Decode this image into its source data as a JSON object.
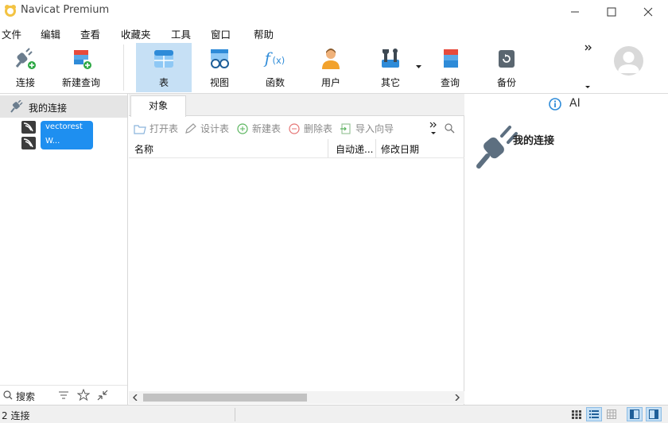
{
  "window": {
    "title": "Navicat Premium"
  },
  "menu": [
    "文件",
    "编辑",
    "查看",
    "收藏夹",
    "工具",
    "窗口",
    "帮助"
  ],
  "toolbar": {
    "connect": "连接",
    "new_query": "新建查询",
    "table": "表",
    "view": "视图",
    "function": "函数",
    "user": "用户",
    "other": "其它",
    "query": "查询",
    "backup": "备份"
  },
  "navigator": {
    "root": "我的连接",
    "connections": [
      "vectorest",
      "W..."
    ],
    "search": "搜索"
  },
  "objects": {
    "tab": "对象",
    "actions": {
      "open_table": "打开表",
      "design_table": "设计表",
      "new_table": "新建表",
      "delete_table": "删除表",
      "import_wizard": "导入向导"
    },
    "columns": [
      "名称",
      "自动递...",
      "修改日期"
    ]
  },
  "info_panel": {
    "ai": "AI",
    "title": "我的连接"
  },
  "status": {
    "connections": "2 连接"
  },
  "colors": {
    "accent": "#1e8ff0",
    "active_tool": "#c6e0f5",
    "plug": "#5d6f80"
  }
}
